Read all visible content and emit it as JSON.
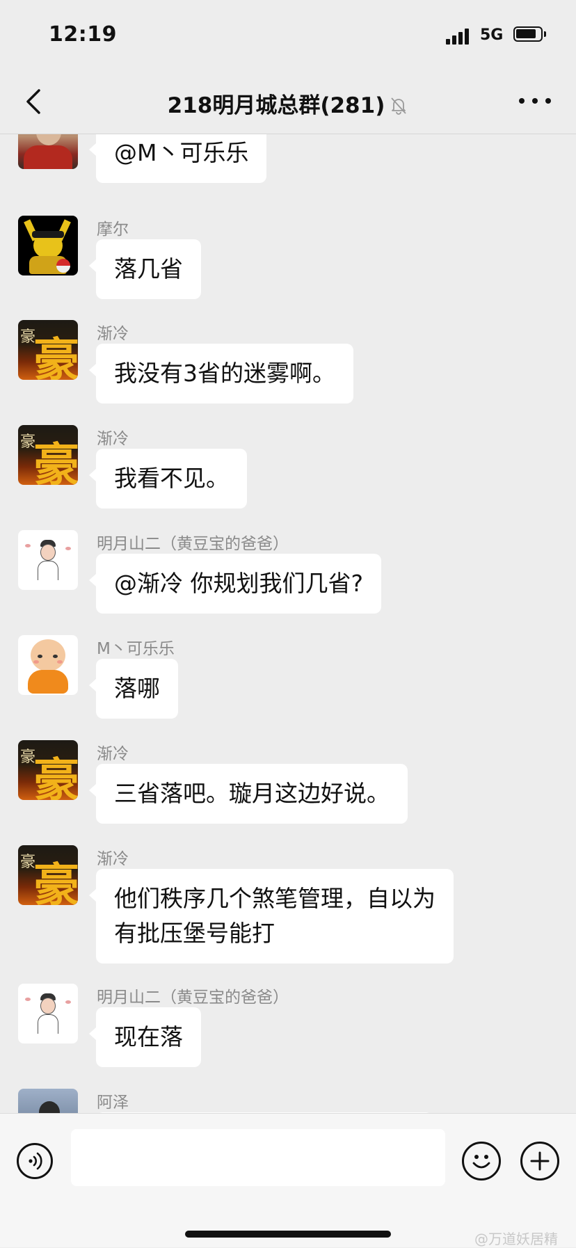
{
  "status_bar": {
    "time": "12:19",
    "network": "5G",
    "battery_level": 0.85
  },
  "nav": {
    "title": "218明月城总群(281)",
    "back_icon": "chevron-left-icon",
    "mute_icon": "bell-off-icon",
    "more_icon": "more-icon"
  },
  "messages": [
    {
      "sender": "",
      "text": "@M丶可乐乐",
      "avatar": "user-photo-avatar"
    },
    {
      "sender": "摩尔",
      "text": "落几省",
      "avatar": "pikachu-avatar"
    },
    {
      "sender": "渐冷",
      "text": "我没有3省的迷雾啊。",
      "avatar": "gao-character-avatar",
      "avatar_chars": [
        "豪",
        "豪"
      ]
    },
    {
      "sender": "渐冷",
      "text": "我看不见。",
      "avatar": "gao-character-avatar",
      "avatar_chars": [
        "豪",
        "豪"
      ]
    },
    {
      "sender": "明月山二（黄豆宝的爸爸）",
      "text": "@渐冷 你规划我们几省?",
      "avatar": "cartoon-boy-avatar"
    },
    {
      "sender": "M丶可乐乐",
      "text": "落哪",
      "avatar": "baby-monk-avatar"
    },
    {
      "sender": "渐冷",
      "text": "三省落吧。璇月这边好说。",
      "avatar": "gao-character-avatar",
      "avatar_chars": [
        "豪",
        "豪"
      ]
    },
    {
      "sender": "渐冷",
      "text_lines": [
        "他们秩序几个煞笔管理，自以为",
        "有批压堡号能打"
      ],
      "avatar": "gao-character-avatar",
      "avatar_chars": [
        "豪",
        "豪"
      ]
    },
    {
      "sender": "明月山二（黄豆宝的爸爸）",
      "text": "现在落",
      "avatar": "cartoon-boy-avatar"
    },
    {
      "sender": "阿泽",
      "text": "",
      "avatar": "user-photo-avatar"
    }
  ],
  "input_bar": {
    "placeholder": "",
    "voice_icon": "voice-icon",
    "emoji_icon": "emoji-icon",
    "plus_icon": "plus-icon"
  },
  "watermark": "@万道妖居精"
}
